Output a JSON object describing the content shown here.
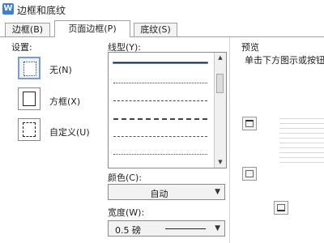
{
  "window": {
    "title": "边框和底纹",
    "icon_letter": "W"
  },
  "tabs": [
    {
      "label": "边框(B)"
    },
    {
      "label": "页面边框(P)"
    },
    {
      "label": "底纹(S)"
    }
  ],
  "settings": {
    "heading": "设置:",
    "options": [
      {
        "label": "无(N)",
        "icon": "no-border-icon"
      },
      {
        "label": "方框(X)",
        "icon": "box-border-icon"
      },
      {
        "label": "自定义(U)",
        "icon": "custom-border-icon"
      }
    ]
  },
  "line_style": {
    "heading": "线型(Y):"
  },
  "color": {
    "heading": "颜色(C):",
    "value": "自动"
  },
  "width": {
    "heading": "宽度(W):",
    "value": "0.5  磅"
  },
  "preview": {
    "heading": "预览",
    "hint": "单击下方图示或按钮"
  },
  "colors": {
    "tab_border": "#a0a0a0",
    "selection": "#7a9cc8"
  }
}
